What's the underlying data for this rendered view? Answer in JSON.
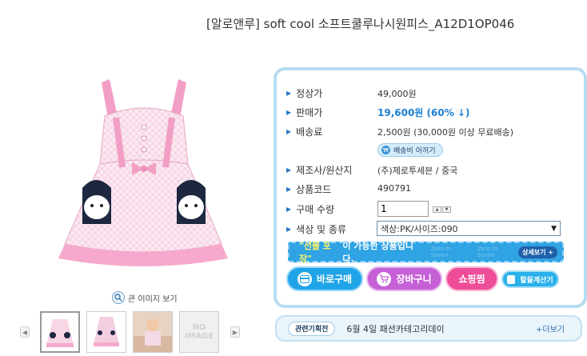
{
  "product": {
    "title": "[알로앤루] soft cool 소프트쿨루나시원피스_A12D1OP046"
  },
  "image": {
    "zoom_label": "큰 이미지 보기",
    "no_image_label": "NO IMAGE"
  },
  "info": {
    "list_price_label": "정상가",
    "list_price": "49,000원",
    "sale_price_label": "판매가",
    "sale_price": "19,600원 (60% ↓)",
    "shipping_label": "배송료",
    "shipping": "2,500원 (30,000원 이상 무료배송)",
    "shipping_info_button": "배송비 아끼기",
    "maker_label": "제조사/원산지",
    "maker": "(주)제로투세븐 / 중국",
    "code_label": "상품코드",
    "code": "490791",
    "quantity_label": "구매 수량",
    "quantity": "1",
    "option_label": "색상 및 종류",
    "option_selected": "색상:PK/사이즈:090"
  },
  "gift": {
    "highlight": "\"선물 포장\"",
    "text": " 이 가능한 상품입니다.",
    "watermark1": "Zero to Seven",
    "watermark2": "Zero to Seven",
    "watermark3": "Zero to Seven",
    "detail_button": "상세보기 +"
  },
  "buttons": {
    "buy": "바로구매",
    "cart": "장바구니",
    "wish": "쇼핑찜",
    "calc": "할들계산기"
  },
  "related": {
    "tag": "관련기획전",
    "text": "6월 4일 패션카테고리데이",
    "more": "+더보기"
  },
  "colors": {
    "accent_blue": "#1fa4e8",
    "sale_blue": "#1c7fd2",
    "cart_purple": "#c560d6",
    "wish_pink": "#ee4d97",
    "box_border": "#b7dcf0"
  },
  "icons": {
    "zoom": "magnifier-icon",
    "buy": "card-icon",
    "cart": "cart-icon",
    "prev": "chevron-left-icon",
    "next": "chevron-right-icon"
  }
}
